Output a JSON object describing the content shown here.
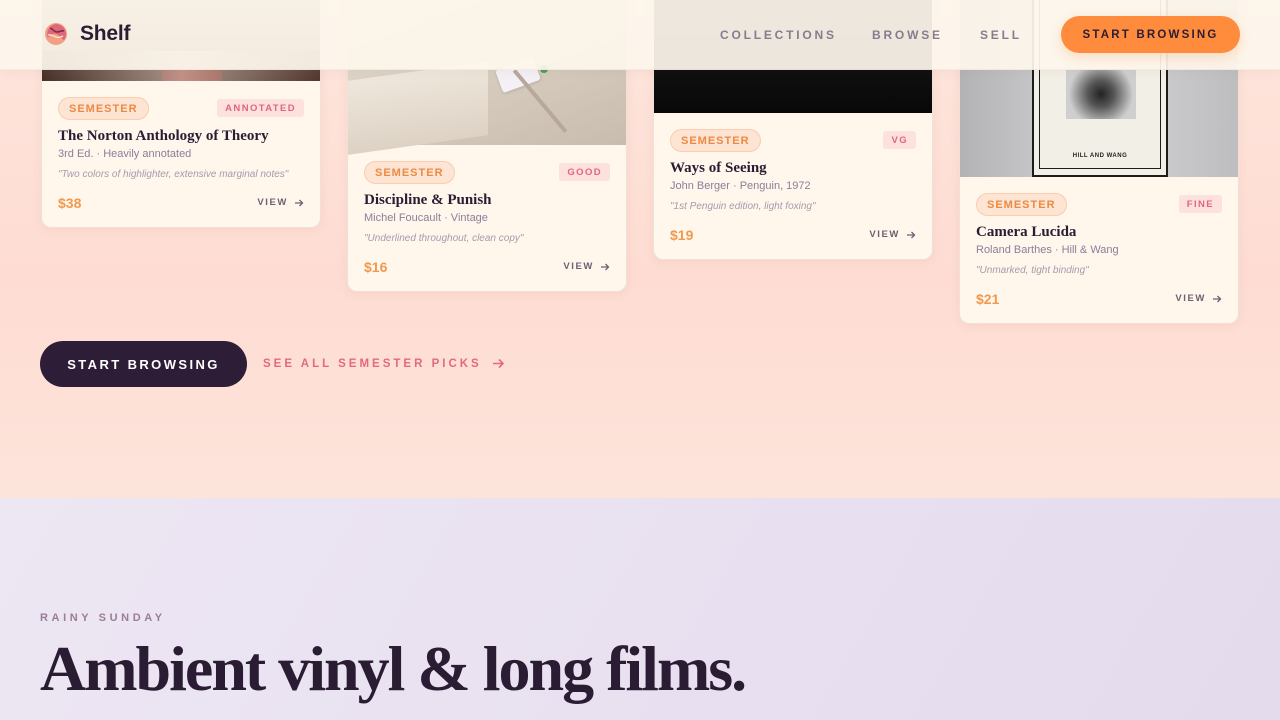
{
  "header": {
    "brand": "Shelf",
    "nav": [
      "COLLECTIONS",
      "BROWSE",
      "SELL"
    ],
    "cta": "START BROWSING"
  },
  "cards": [
    {
      "tag": "SEMESTER",
      "condition": "ANNOTATED",
      "title": "The Norton Anthology of Theory",
      "meta": "3rd Ed. · Heavily annotated",
      "note": "\"Two colors of highlighter, extensive marginal notes\"",
      "price": "$38",
      "view": "VIEW"
    },
    {
      "tag": "SEMESTER",
      "condition": "GOOD",
      "title": "Discipline & Punish",
      "meta": "Michel Foucault · Vintage",
      "note": "\"Underlined throughout, clean copy\"",
      "price": "$16",
      "view": "VIEW"
    },
    {
      "tag": "SEMESTER",
      "condition": "VG",
      "title": "Ways of Seeing",
      "meta": "John Berger · Penguin, 1972",
      "note": "\"1st Penguin edition, light foxing\"",
      "price": "$19",
      "view": "VIEW"
    },
    {
      "tag": "SEMESTER",
      "condition": "FINE",
      "title": "Camera Lucida",
      "meta": "Roland Barthes · Hill & Wang",
      "note": "\"Unmarked, tight binding\"",
      "price": "$21",
      "view": "VIEW",
      "cover_text": "HILL AND WANG"
    }
  ],
  "actions": {
    "primary": "START BROWSING",
    "secondary": "SEE ALL SEMESTER PICKS"
  },
  "section": {
    "eyebrow": "RAINY SUNDAY",
    "headline": "Ambient vinyl & long films."
  },
  "colors": {
    "accent": "#ff8c3c",
    "dark": "#2e1d36",
    "pink": "#e26a7d"
  }
}
